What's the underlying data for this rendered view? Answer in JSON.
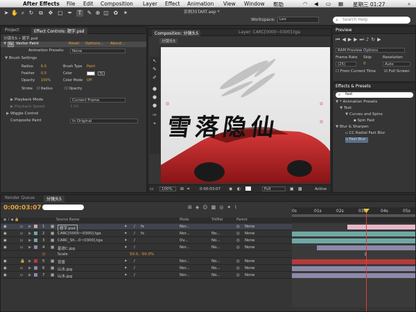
{
  "menubar": {
    "apple": "",
    "app": "After Effects",
    "items": [
      "File",
      "Edit",
      "Composition",
      "Layer",
      "Effect",
      "Animation",
      "View",
      "Window",
      "帮助"
    ],
    "clock": "星期三 01:27"
  },
  "title": "实例35TART.aep *",
  "workspace": {
    "label": "Workspace:",
    "value": "Leo"
  },
  "search": {
    "placeholder": "Search Help"
  },
  "effect_controls": {
    "tab_project": "Project",
    "tab_ec": "Effect Controls: 题字.psd",
    "breadcrumb": "分镜头5 • 题字.psd",
    "effect_name": "Vector Paint",
    "reset": "Reset",
    "options": "Options...",
    "about": "About...",
    "anim_presets_label": "Animation Presets:",
    "anim_presets_value": "None",
    "brush_settings": "Brush Settings",
    "radius_label": "Radius",
    "radius_val": "6.0",
    "brush_type_label": "Brush Type",
    "brush_type_val": "Paint",
    "feather_label": "Feather",
    "feather_val": "0.0",
    "color_label": "Color",
    "opacity_label": "Opacity",
    "opacity_val": "100%",
    "color_mode_label": "Color Mode",
    "color_mode_val": "Off",
    "stroke_label": "Stroke",
    "radius_btn": "Radius",
    "opacity_btn": "Opacity",
    "playback_mode": "Playback Mode",
    "playback_mode_val": "Current Frame",
    "playback_speed": "Playback Speed",
    "playback_speed_val": "3.00",
    "wiggle": "Wiggle Control",
    "composite": "Composite Paint",
    "composite_val": "In Original"
  },
  "comp": {
    "tab": "Composition: 分镜头5",
    "layer_tab": "Layer: CARC[0000~0300].tga",
    "sub_tab": "分镜头5",
    "calligraphy": "雪落隐仙",
    "zoom": "100%",
    "timecode": "0:00:03:07",
    "resolution": "Full",
    "view": "Active"
  },
  "preview": {
    "tab": "Preview",
    "ram_preview": "RAM Preview Options",
    "frame_rate_label": "Frame Rate",
    "skip_label": "Skip",
    "resolution_label": "Resolution",
    "frame_rate_val": "(25)",
    "skip_val": "0",
    "resolution_val": "Auto",
    "from_current": "From Current Time",
    "full_screen": "Full Screen"
  },
  "effects_presets": {
    "tab": "Effects & Presets",
    "search_value": "fast",
    "items": [
      {
        "label": "* Animation Presets",
        "level": 0
      },
      {
        "label": "Text",
        "level": 1
      },
      {
        "label": "Curves and Spins",
        "level": 2
      },
      {
        "label": "Spin Fast",
        "level": 3
      },
      {
        "label": "Blur & Sharpen",
        "level": 0
      },
      {
        "label": "CC Radial Fast Blur",
        "level": 2
      },
      {
        "label": "Fast Blur",
        "level": 2
      }
    ]
  },
  "timeline": {
    "tab_render": "Render Queue",
    "tab_comp": "分镜头5",
    "timecode": "0:00:03:07",
    "col_source": "Source Name",
    "col_mode": "Mode",
    "col_trkmat": "TrkMat",
    "col_parent": "Parent",
    "ruler": [
      "0s",
      "01s",
      "02s",
      "03s",
      "04s",
      "05s"
    ],
    "layers": [
      {
        "num": "1",
        "name": "题字.psd",
        "mode": "Nor...",
        "trk": "",
        "parent": "None"
      },
      {
        "num": "2",
        "name": "CARC[0000~0300].tga",
        "mode": "Nor...",
        "trk": "No...",
        "parent": "None"
      },
      {
        "num": "3",
        "name": "CARC_Sh...0~0300].tga",
        "mode": "Ov...",
        "trk": "No...",
        "parent": "None"
      },
      {
        "num": "4",
        "name": "星迹C.jpg",
        "mode": "Nor...",
        "trk": "No...",
        "parent": "None"
      },
      {
        "num": "",
        "name": "Scale",
        "mode": "",
        "trk": "",
        "parent": "",
        "extra": "50.0, -50.0%"
      },
      {
        "num": "5",
        "name": "背景",
        "mode": "Nor...",
        "trk": "No...",
        "parent": "None"
      },
      {
        "num": "6",
        "name": "山水.jpg",
        "mode": "Nor...",
        "trk": "No...",
        "parent": "None"
      },
      {
        "num": "7",
        "name": "山水.jpg",
        "mode": "Nor...",
        "trk": "No...",
        "parent": "None"
      }
    ]
  },
  "colors": {
    "red_car": "#c2262b",
    "layer_teal": "#6fa8a6",
    "layer_pink": "#e6b8c8",
    "layer_purple": "#8c8aa8",
    "layer_red": "#b53a3a",
    "playhead": "#e23c3c"
  }
}
